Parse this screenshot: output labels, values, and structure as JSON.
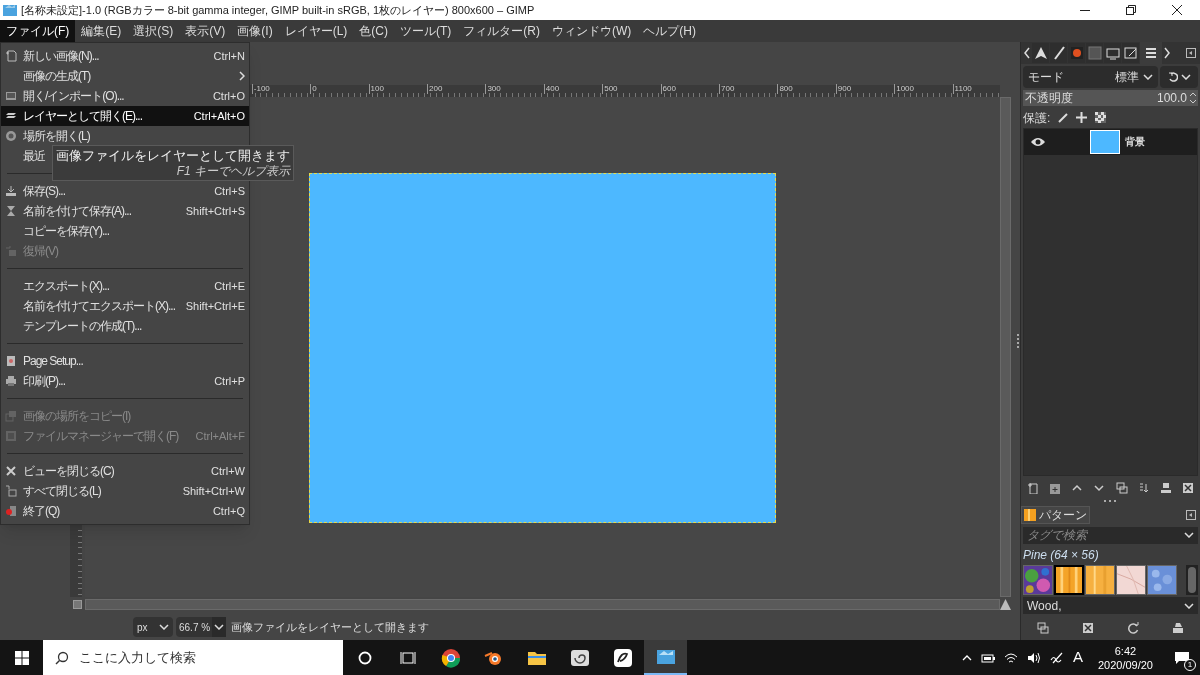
{
  "window": {
    "title": "[名称未設定]-1.0 (RGBカラー 8-bit gamma integer, GIMP built-in sRGB, 1枚のレイヤー) 800x600 – GIMP"
  },
  "menubar": [
    {
      "label": "ファイル(F)",
      "selected": true
    },
    {
      "label": "編集(E)",
      "selected": false
    },
    {
      "label": "選択(S)",
      "selected": false
    },
    {
      "label": "表示(V)",
      "selected": false
    },
    {
      "label": "画像(I)",
      "selected": false
    },
    {
      "label": "レイヤー(L)",
      "selected": false
    },
    {
      "label": "色(C)",
      "selected": false
    },
    {
      "label": "ツール(T)",
      "selected": false
    },
    {
      "label": "フィルター(R)",
      "selected": false
    },
    {
      "label": "ウィンドウ(W)",
      "selected": false
    },
    {
      "label": "ヘルプ(H)",
      "selected": false
    }
  ],
  "file_menu": [
    {
      "kind": "item",
      "label": "新しい画像(N)...",
      "shortcut": "Ctrl+N",
      "disabled": false,
      "selected": false
    },
    {
      "kind": "submenu",
      "label": "画像の生成(T)",
      "disabled": false,
      "selected": false
    },
    {
      "kind": "item",
      "label": "開く/インポート(O)...",
      "shortcut": "Ctrl+O",
      "disabled": false,
      "selected": false
    },
    {
      "kind": "item",
      "label": "レイヤーとして開く(E)...",
      "shortcut": "Ctrl+Alt+O",
      "disabled": false,
      "selected": true
    },
    {
      "kind": "item",
      "label": "場所を開く(L)",
      "disabled": false,
      "selected": false
    },
    {
      "kind": "item",
      "label": "最近",
      "disabled": false,
      "selected": false
    },
    {
      "kind": "separator"
    },
    {
      "kind": "item",
      "label": "保存(S)...",
      "shortcut": "Ctrl+S",
      "disabled": false,
      "selected": false
    },
    {
      "kind": "item",
      "label": "名前を付けて保存(A)...",
      "shortcut": "Shift+Ctrl+S",
      "disabled": false,
      "selected": false
    },
    {
      "kind": "item",
      "label": "コピーを保存(Y)...",
      "disabled": false,
      "selected": false
    },
    {
      "kind": "item",
      "label": "復帰(V)",
      "disabled": true,
      "selected": false
    },
    {
      "kind": "separator"
    },
    {
      "kind": "item",
      "label": "エクスポート(X)...",
      "shortcut": "Ctrl+E",
      "disabled": false,
      "selected": false
    },
    {
      "kind": "item",
      "label": "名前を付けてエクスポート(X)...",
      "shortcut": "Shift+Ctrl+E",
      "disabled": false,
      "selected": false
    },
    {
      "kind": "item",
      "label": "テンプレートの作成(T)...",
      "disabled": false,
      "selected": false
    },
    {
      "kind": "separator"
    },
    {
      "kind": "item",
      "label": "Page Setup...",
      "disabled": false,
      "selected": false
    },
    {
      "kind": "item",
      "label": "印刷(P)...",
      "shortcut": "Ctrl+P",
      "disabled": false,
      "selected": false
    },
    {
      "kind": "separator"
    },
    {
      "kind": "item",
      "label": "画像の場所をコピー(I)",
      "disabled": true,
      "selected": false
    },
    {
      "kind": "item",
      "label": "ファイルマネージャーで開く(F)",
      "shortcut": "Ctrl+Alt+F",
      "disabled": true,
      "selected": false
    },
    {
      "kind": "separator"
    },
    {
      "kind": "item",
      "label": "ビューを閉じる(C)",
      "shortcut": "Ctrl+W",
      "disabled": false,
      "selected": false
    },
    {
      "kind": "item",
      "label": "すべて閉じる(L)",
      "shortcut": "Shift+Ctrl+W",
      "disabled": false,
      "selected": false
    },
    {
      "kind": "item",
      "label": "終了(Q)",
      "shortcut": "Ctrl+Q",
      "disabled": false,
      "selected": false
    }
  ],
  "tooltip": {
    "text": "画像ファイルをレイヤーとして開きます",
    "hint": "F1 キーでヘルプ表示"
  },
  "ruler": [
    "-100",
    "0",
    "100",
    "200",
    "300",
    "400",
    "500",
    "600",
    "700",
    "800",
    "900",
    "1000",
    "1100"
  ],
  "status_bar": {
    "unit": "px",
    "zoom": "66.7 %",
    "message": "画像ファイルをレイヤーとして開きます"
  },
  "layers_panel": {
    "mode_label": "モード",
    "mode": "標準",
    "opacity_label": "不透明度",
    "opacity": "100.0",
    "level": 1,
    "lock_label": "保護:",
    "layers": [
      {
        "name": "背景",
        "visible": true,
        "selected": true
      }
    ]
  },
  "patterns_panel": {
    "tab": "パターン",
    "search_placeholder": "タグで検索",
    "pattern_name": "Pine (64 × 56)",
    "tag": "Wood,",
    "patterns": [
      {
        "selected": false
      },
      {
        "selected": true
      },
      {
        "selected": false
      },
      {
        "selected": false
      },
      {
        "selected": false
      }
    ]
  },
  "taskbar": {
    "search_placeholder": "ここに入力して検索",
    "apps": [
      {
        "selected": false
      },
      {
        "selected": false
      },
      {
        "selected": false
      },
      {
        "selected": false
      },
      {
        "selected": false
      },
      {
        "selected": true
      }
    ],
    "ime": "A",
    "time": "6:42",
    "date": "2020/09/20",
    "notifications": "1"
  }
}
